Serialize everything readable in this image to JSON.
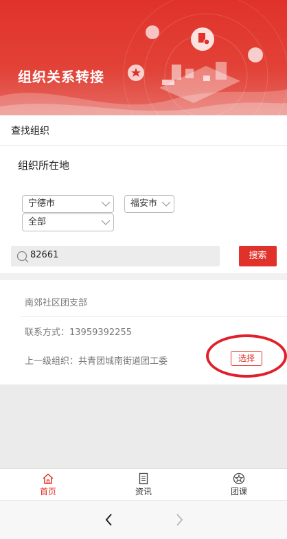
{
  "banner": {
    "title": "组织关系转接"
  },
  "section": {
    "title": "查找组织"
  },
  "filter": {
    "location_label": "组织所在地",
    "city": "宁德市",
    "district": "福安市",
    "scope": "全部"
  },
  "search": {
    "value": "82661",
    "button_label": "搜索"
  },
  "result": {
    "org_name": "南郊社区团支部",
    "contact": "联系方式：13959392255",
    "parent": "上一级组织：共青团城南街道团工委",
    "select_label": "选择"
  },
  "tabbar": {
    "items": [
      {
        "label": "首页",
        "icon": "home-icon",
        "active": true
      },
      {
        "label": "资讯",
        "icon": "document-icon",
        "active": false
      },
      {
        "label": "团课",
        "icon": "star-badge-icon",
        "active": false
      }
    ]
  },
  "colors": {
    "brand": "#e0322a",
    "background": "#ebebeb"
  },
  "nav": {
    "back_icon": "chevron-left-icon",
    "forward_icon": "chevron-right-icon"
  }
}
